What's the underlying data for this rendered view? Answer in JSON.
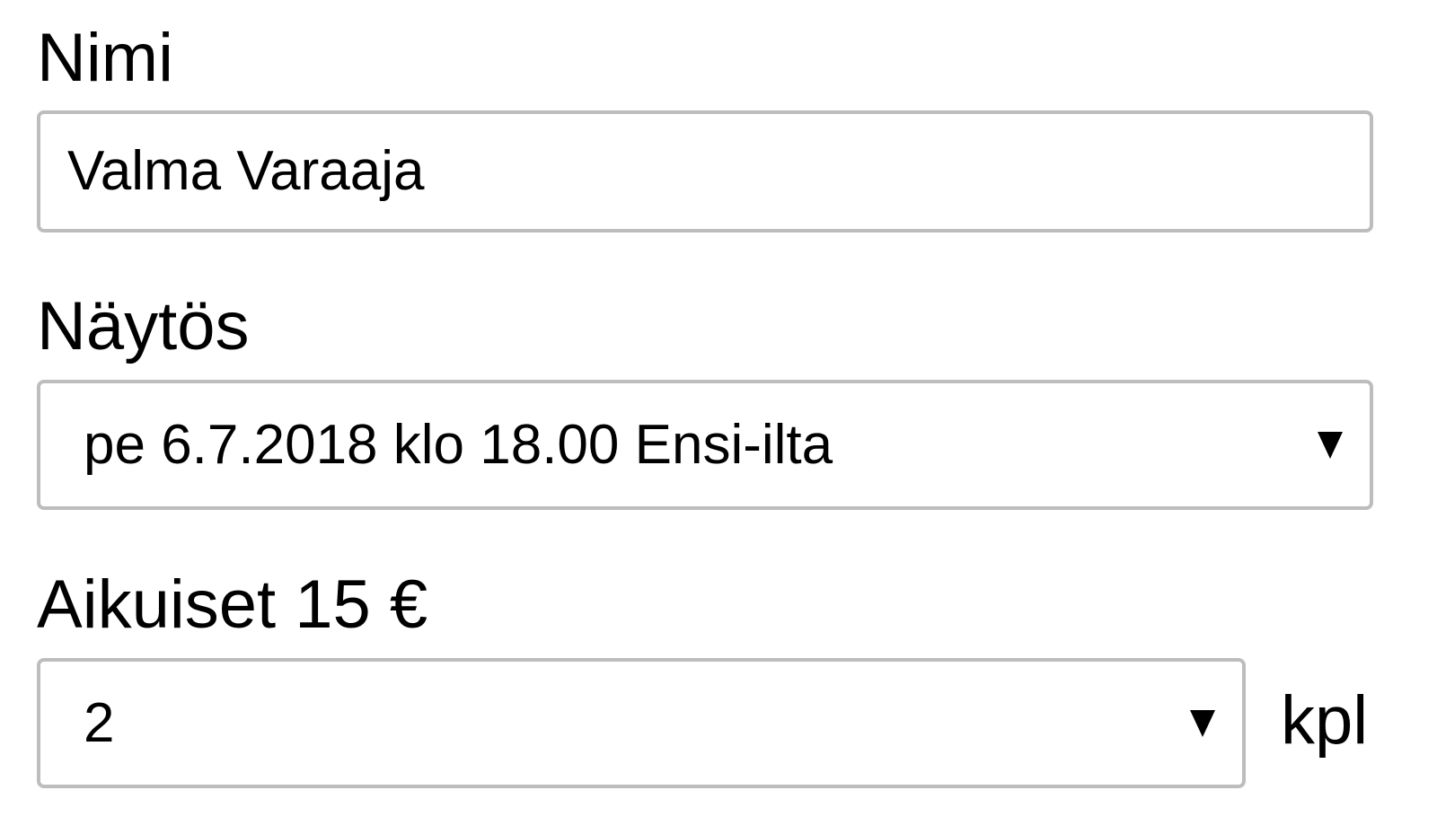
{
  "name_field": {
    "label": "Nimi",
    "value": "Valma Varaaja"
  },
  "show_field": {
    "label": "Näytös",
    "selected": "pe 6.7.2018 klo 18.00 Ensi-ilta"
  },
  "adults_field": {
    "label": "Aikuiset 15 €",
    "selected": "2",
    "unit": "kpl"
  },
  "icons": {
    "dropdown": "chevron-down-icon"
  },
  "colors": {
    "border": "#bdbdbd",
    "text": "#000000",
    "background": "#ffffff"
  }
}
